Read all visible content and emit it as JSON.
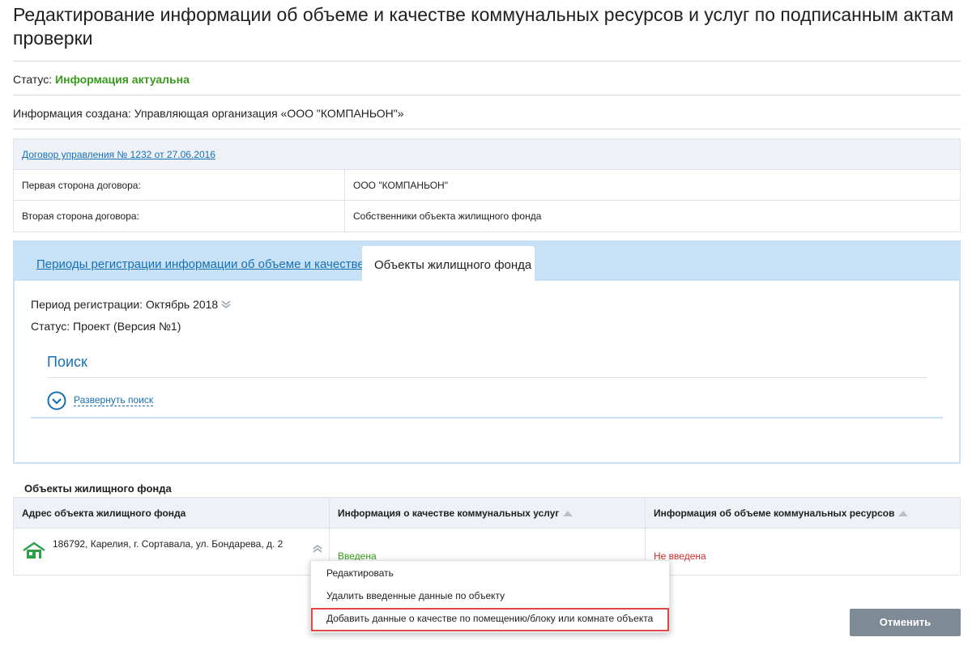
{
  "page": {
    "title": "Редактирование информации об объеме и качестве коммунальных ресурсов и услуг по подписанным актам проверки",
    "status_label": "Статус: ",
    "status_value": "Информация актуальна",
    "created_text": "Информация создана: Управляющая организация «ООО \"КОМПАНЬОН\"»"
  },
  "contract": {
    "link": "Договор управления № 1232 от 27.06.2016",
    "rows": [
      {
        "label": "Первая сторона договора:",
        "value": "ООО \"КОМПАНЬОН\""
      },
      {
        "label": "Вторая сторона договора:",
        "value": "Собственники объекта жилищного фонда"
      }
    ]
  },
  "tabs": {
    "periods": "Периоды регистрации информации об объеме и качестве",
    "objects": "Объекты жилищного фонда"
  },
  "period": {
    "registration": "Период регистрации: Октябрь 2018",
    "status": "Статус: Проект (Версия №1)"
  },
  "search": {
    "title": "Поиск",
    "expand": "Развернуть поиск"
  },
  "objects_table": {
    "title": "Объекты жилищного фонда",
    "headers": [
      "Адрес объекта жилищного фонда",
      "Информация о качестве коммунальных услуг",
      "Информация об объеме коммунальных ресурсов"
    ],
    "rows": [
      {
        "address": "186792, Карелия, г. Сортавала, ул. Бондарева, д. 2",
        "quality": "Введена",
        "volume": "Не введена"
      }
    ]
  },
  "context_menu": {
    "items": [
      "Редактировать",
      "Удалить введенные данные по объекту",
      "Добавить данные о качестве по помещению/блоку или комнате объекта"
    ]
  },
  "actions": {
    "cancel": "Отменить"
  },
  "colors": {
    "link": "#1670b5",
    "ok": "#3a9a1d",
    "error": "#d12b2b",
    "highlight": "#e04848",
    "tab_bar": "#c7e1f6",
    "button": "#7e8a95"
  },
  "icons": [
    "chevron-double-down-icon",
    "expand-circle-icon",
    "house-icon",
    "chevron-double-up-icon"
  ]
}
